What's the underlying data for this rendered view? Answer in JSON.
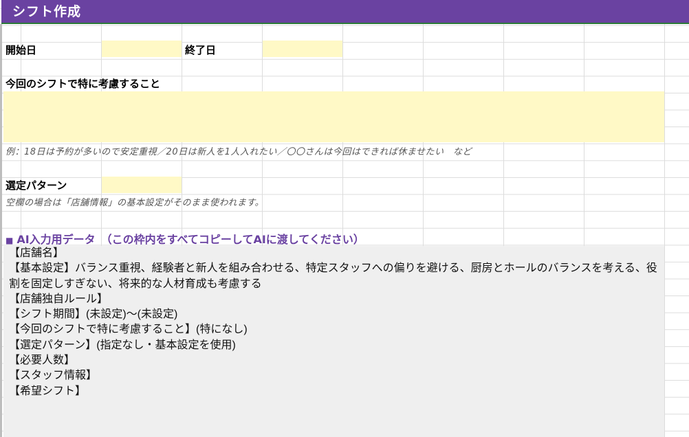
{
  "title": "シフト作成",
  "fields": {
    "start_label": "開始日",
    "end_label": "終了日",
    "consider_label": "今回のシフトで特に考慮すること",
    "consider_example": "例：18日は予約が多いので安定重視／20日は新人を1人入れたい／〇〇さんは今回はできれば休ませたい　など",
    "pattern_label": "選定パターン",
    "pattern_hint": "空欄の場合は「店舗情報」の基本設定がそのまま使われます。"
  },
  "ai_section": {
    "header": "AI入力用データ　（この枠内をすべてコピーしてAIに渡してください）",
    "lines": [
      "【店舗名】",
      "【基本設定】バランス重視、経験者と新人を組み合わせる、特定スタッフへの偏りを避ける、厨房とホールのバランスを考える、役割を固定しすぎない、将来的な人材育成も考慮する",
      "【店舗独自ルール】",
      "【シフト期間】(未設定)〜(未設定)",
      "【今回のシフトで特に考慮すること】(特になし)",
      "【選定パターン】(指定なし・基本設定を使用)",
      "【必要人数】",
      "【スタッフ情報】",
      "【希望シフト】"
    ]
  },
  "colors": {
    "title_bg": "#6a42a1",
    "input_bg": "#fff9c6",
    "ai_box_bg": "#efefef"
  }
}
